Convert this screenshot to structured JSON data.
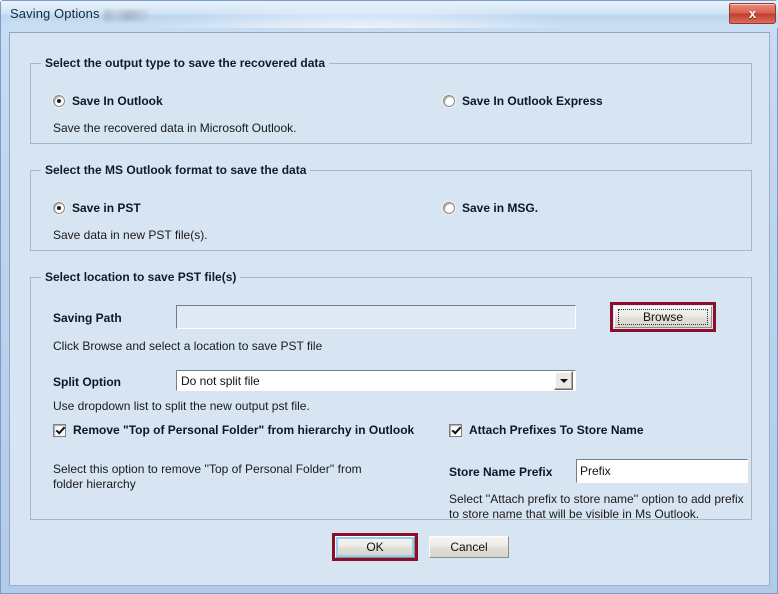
{
  "window": {
    "title": "Saving Options",
    "close_label": "x",
    "accent_highlight_color": "#8b0e2a",
    "client_bg_color": "#d7e4f2"
  },
  "group_output_type": {
    "title": "Select the output type to save the recovered data",
    "options": [
      {
        "label": "Save In Outlook",
        "checked": true
      },
      {
        "label": "Save In Outlook Express",
        "checked": false
      }
    ],
    "hint": "Save the recovered data in Microsoft Outlook."
  },
  "group_outlook_format": {
    "title": "Select the MS Outlook format to save the data",
    "options": [
      {
        "label": "Save in PST",
        "checked": true
      },
      {
        "label": "Save in MSG.",
        "checked": false
      }
    ],
    "hint": "Save data in new PST file(s)."
  },
  "group_location": {
    "title": "Select location to save PST file(s)",
    "saving_path_label": "Saving Path",
    "saving_path_value": "",
    "saving_path_placeholder": "",
    "browse_label": "Browse",
    "browse_hint": "Click Browse and select a location to save PST file",
    "split_option_label": "Split Option",
    "split_option_value": "Do not split file",
    "split_option_hint": "Use dropdown list to split the new output pst file.",
    "remove_top_checkbox": {
      "label": "Remove \"Top of Personal Folder\" from hierarchy in Outlook",
      "checked": true
    },
    "remove_top_hint": "Select this option to remove ''Top of Personal Folder'' from folder hierarchy",
    "attach_prefix_checkbox": {
      "label": "Attach Prefixes To Store Name",
      "checked": true
    },
    "store_name_prefix_label": "Store Name Prefix",
    "store_name_prefix_value": "Prefix",
    "attach_prefix_hint": "Select ''Attach prefix to store name'' option to add prefix to store name that will be visible in Ms Outlook."
  },
  "footer": {
    "ok_label": "OK",
    "cancel_label": "Cancel"
  }
}
